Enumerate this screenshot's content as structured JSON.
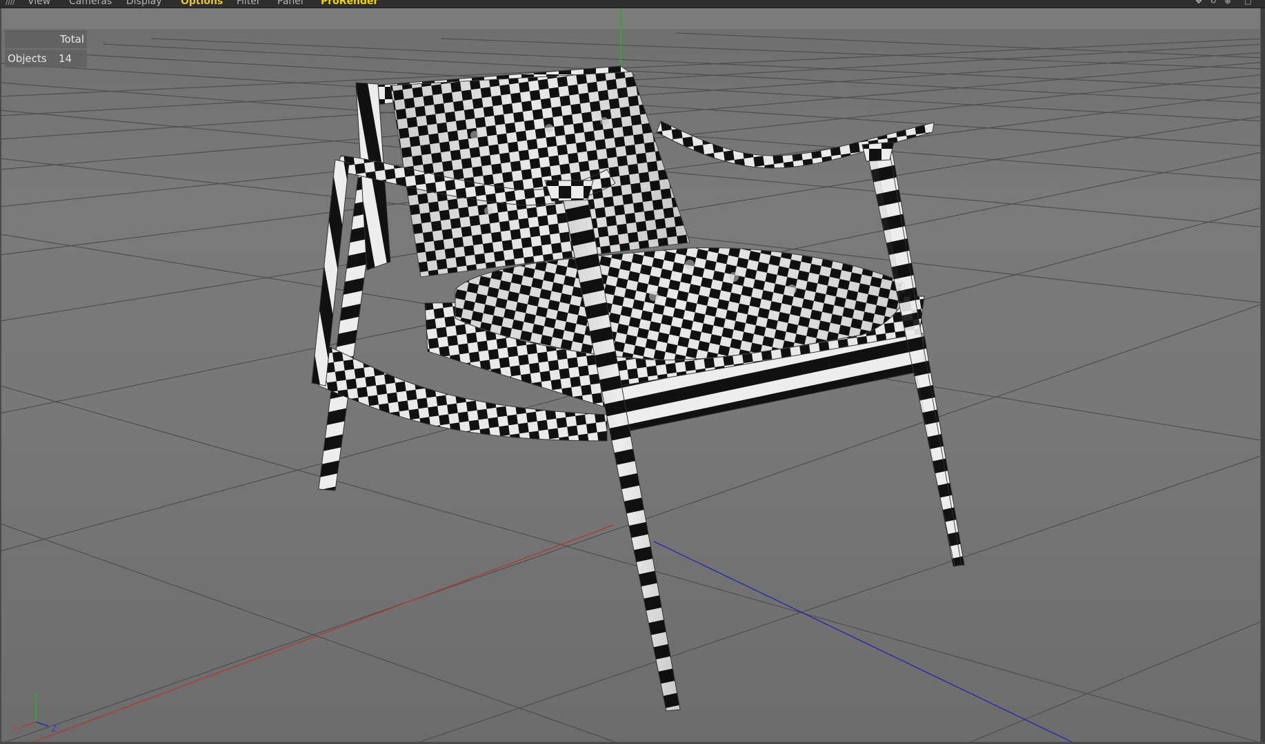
{
  "menubar": {
    "items": [
      {
        "label": "View",
        "state": "normal"
      },
      {
        "label": "Cameras",
        "state": "normal"
      },
      {
        "label": "Display",
        "state": "normal"
      },
      {
        "label": "Options",
        "state": "active"
      },
      {
        "label": "Filter",
        "state": "normal"
      },
      {
        "label": "Panel",
        "state": "normal"
      },
      {
        "label": "ProRender",
        "state": "accent"
      }
    ],
    "nav_icons": [
      "move-view-icon",
      "rotate-view-icon",
      "zoom-view-icon",
      "maximize-view-icon"
    ]
  },
  "hud": {
    "header": "Total",
    "rows": [
      {
        "label": "Objects",
        "value": "14"
      }
    ]
  },
  "gizmo": {
    "y_label": "Y",
    "x_label": "X",
    "z_label": "Z"
  },
  "colors": {
    "menu_active": "#e8c33c",
    "menu_accent": "#f0d400",
    "axis_x": "#b03a36",
    "axis_y": "#2bb02b",
    "axis_z": "#2a2ab0",
    "grid": "#4f4f4f",
    "checker_dark": "#111111",
    "checker_light": "#ececec"
  },
  "viewport": {
    "mode": "perspective",
    "object": "armchair",
    "material": "checkerboard"
  }
}
